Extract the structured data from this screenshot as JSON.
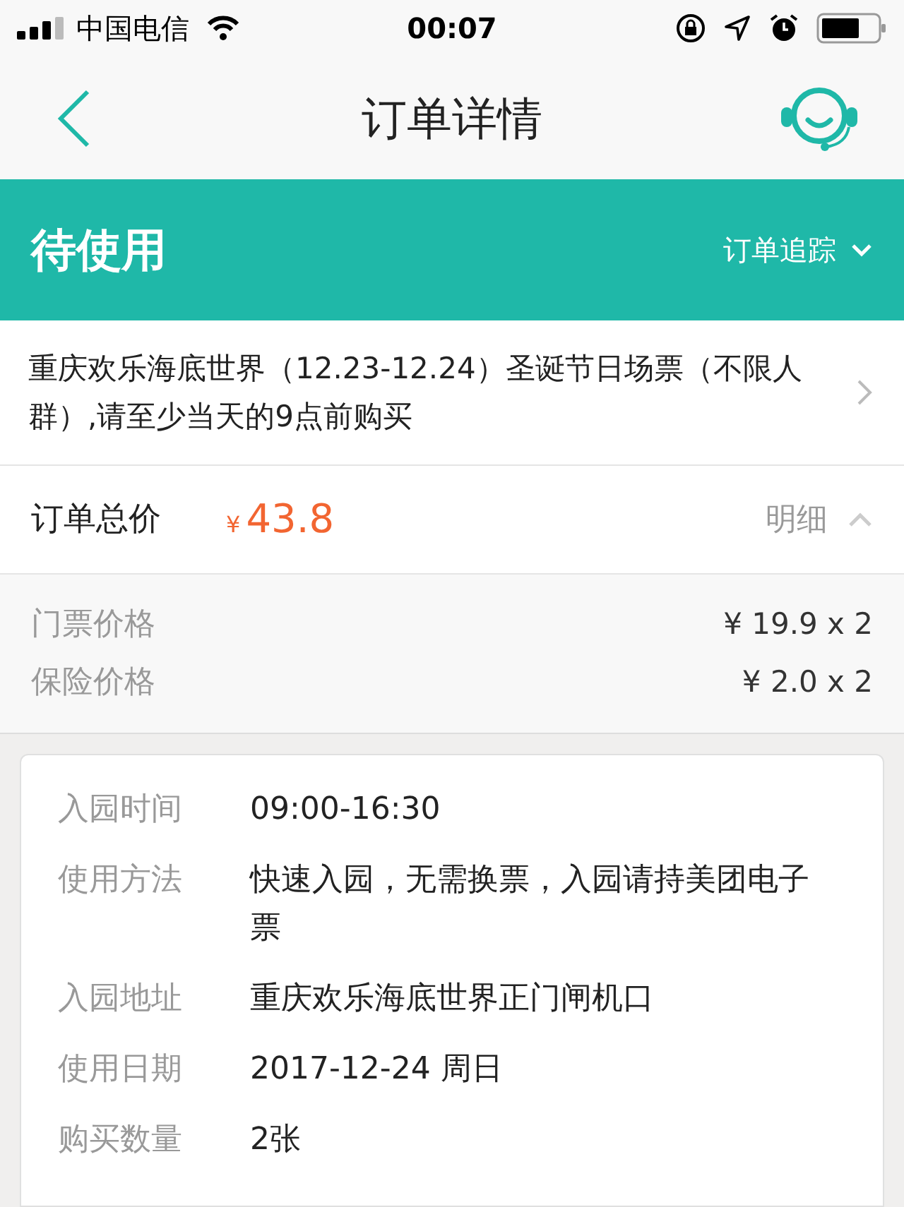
{
  "status_bar": {
    "carrier": "中国电信",
    "time": "00:07"
  },
  "nav": {
    "title": "订单详情"
  },
  "banner": {
    "status": "待使用",
    "tracking_link": "订单追踪"
  },
  "product": {
    "title": "重庆欢乐海底世界（12.23-12.24）圣诞节日场票（不限人群）,请至少当天的9点前购买"
  },
  "total": {
    "label": "订单总价",
    "currency": "¥",
    "amount": "43.8",
    "details_link": "明细",
    "expanded": true
  },
  "price_rows": [
    {
      "label": "门票价格",
      "value": "¥ 19.9 x 2"
    },
    {
      "label": "保险价格",
      "value": "¥ 2.0 x 2"
    }
  ],
  "info_rows": [
    {
      "label": "入园时间",
      "value": "09:00-16:30"
    },
    {
      "label": "使用方法",
      "value": "快速入园，无需换票，入园请持美团电子票"
    },
    {
      "label": "入园地址",
      "value": "重庆欢乐海底世界正门闸机口"
    },
    {
      "label": "使用日期",
      "value": "2017-12-24 周日"
    },
    {
      "label": "购买数量",
      "value": "2张"
    }
  ]
}
